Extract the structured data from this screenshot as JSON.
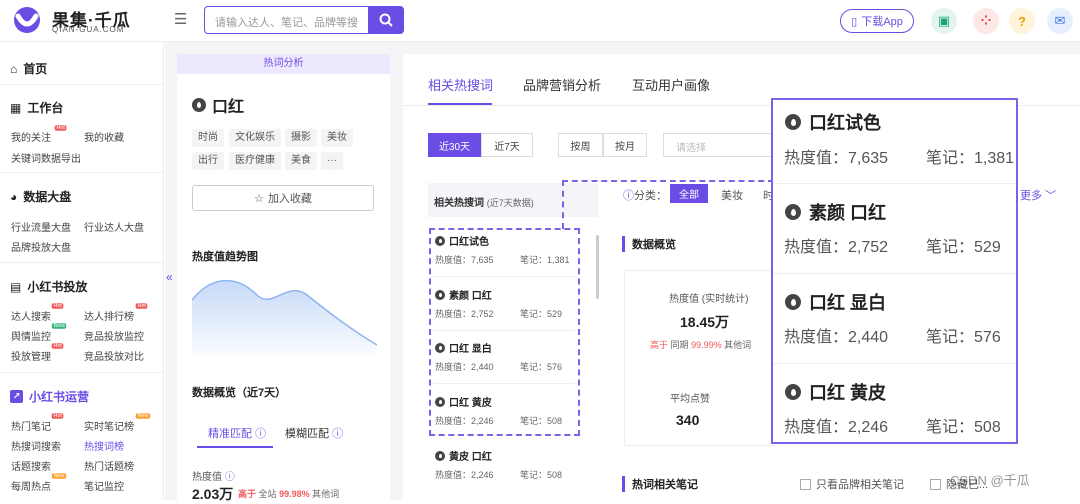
{
  "brand": {
    "name": "果集·千瓜",
    "sub": "QIAN-GUA.COM",
    "color": "#6b4de6"
  },
  "search": {
    "placeholder": "请输入达人、笔记、品牌等搜"
  },
  "header": {
    "download_label": "下载App",
    "help_label": "?"
  },
  "sidebar": {
    "home": "首页",
    "sections": [
      {
        "title": "工作台",
        "items": [
          "我的关注",
          "我的收藏",
          "关键词数据导出"
        ]
      },
      {
        "title": "数据大盘",
        "items": [
          "行业流量大盘",
          "行业达人大盘",
          "品牌投放大盘"
        ]
      },
      {
        "title": "小红书投放",
        "items": [
          "达人搜索",
          "达人排行榜",
          "舆情监控",
          "竞品投放监控",
          "投放管理",
          "竞品投放对比"
        ]
      },
      {
        "title": "小红书运营",
        "items": [
          "热门笔记",
          "实时笔记榜",
          "热搜词搜索",
          "热搜词榜",
          "话题搜索",
          "热门话题榜",
          "每周热点",
          "笔记监控"
        ]
      }
    ],
    "badges": {
      "hot": "Hot",
      "beta": "Beta",
      "new": "New"
    },
    "collapse": "«"
  },
  "left_panel": {
    "tab": "热词分析",
    "keyword": "口红",
    "tags": [
      "时尚",
      "文化娱乐",
      "摄影",
      "美妆",
      "出行",
      "医疗健康",
      "美食",
      "···"
    ],
    "favorite_label": "加入收藏",
    "trend_title": "热度值趋势图",
    "overview_title": "数据概览（近7天）",
    "match_tabs": [
      "精准匹配",
      "模糊匹配"
    ],
    "heat_label": "热度值",
    "heat_value": "2.03万",
    "heat_compare": {
      "prefix": "高于",
      "scope": "全站",
      "pct": "99.98%",
      "suffix": "其他词"
    }
  },
  "main": {
    "tabs": [
      "相关热搜词",
      "品牌营销分析",
      "互动用户画像"
    ],
    "ranges": [
      "近30天",
      "近7天"
    ],
    "granularity": [
      "按周",
      "按月"
    ],
    "select_placeholder": "请选择",
    "list_title": "相关热搜词",
    "list_subtitle": "(近7天数据)",
    "stat_heat_label": "热度值：",
    "stat_notes_label": "笔记：",
    "keywords": [
      {
        "name": "口红试色",
        "heat": "7,635",
        "notes": "1,381"
      },
      {
        "name": "素颜 口红",
        "heat": "2,752",
        "notes": "529"
      },
      {
        "name": "口红 显白",
        "heat": "2,440",
        "notes": "576"
      },
      {
        "name": "口红 黄皮",
        "heat": "2,246",
        "notes": "508"
      },
      {
        "name": "黄皮 口红",
        "heat": "2,246",
        "notes": "508"
      }
    ],
    "filter_label": "分类：",
    "filter_options": [
      "全部",
      "美妆",
      "时"
    ],
    "more_label": "更多",
    "overview_title": "数据概览",
    "stat_label": "热度值 (实时统计)",
    "stat_value": "18.45万",
    "stat_compare": {
      "prefix": "高于",
      "scope": "同期",
      "pct": "99.99%",
      "suffix": "其他词"
    },
    "likes_label": "平均点赞",
    "likes_value": "340",
    "notes_title": "热词相关笔记",
    "checkbox1": "只看品牌相关笔记",
    "checkbox2": "隐藏已..."
  },
  "zoom": {
    "heat_label": "热度值：",
    "notes_label": "笔记：",
    "items": [
      {
        "name": "口红试色",
        "heat": "7,635",
        "notes": "1,381"
      },
      {
        "name": "素颜 口红",
        "heat": "2,752",
        "notes": "529"
      },
      {
        "name": "口红 显白",
        "heat": "2,440",
        "notes": "576"
      },
      {
        "name": "口红 黄皮",
        "heat": "2,246",
        "notes": "508"
      }
    ]
  },
  "watermark": "CSDN @千瓜"
}
